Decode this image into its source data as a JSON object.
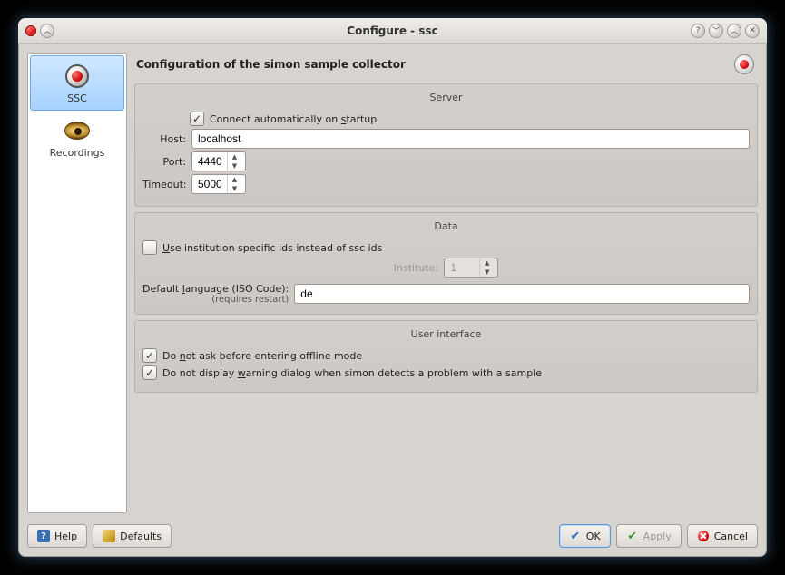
{
  "window": {
    "title": "Configure - ssc"
  },
  "sidebar": {
    "items": [
      {
        "label": "SSC",
        "active": true
      },
      {
        "label": "Recordings",
        "active": false
      }
    ]
  },
  "header": {
    "title": "Configuration of the simon sample collector"
  },
  "server": {
    "group_title": "Server",
    "connect_auto_prefix": "Connect automatically on ",
    "connect_auto_ul": "s",
    "connect_auto_suffix": "tartup",
    "connect_auto_checked": true,
    "host_label": "Host:",
    "host_value": "localhost",
    "port_label": "Port:",
    "port_value": "4440",
    "timeout_label": "Timeout:",
    "timeout_value": "5000"
  },
  "data_sec": {
    "group_title": "Data",
    "inst_ids_ul": "U",
    "inst_ids_suffix": "se institution specific ids instead of ssc ids",
    "inst_ids_checked": false,
    "institute_label": "Institute:",
    "institute_value": "1",
    "lang_label_prefix": "Default ",
    "lang_label_ul": "l",
    "lang_label_suffix": "anguage (ISO Code):",
    "lang_note": "(requires restart)",
    "lang_value": "de"
  },
  "ui_sec": {
    "group_title": "User interface",
    "offline_prefix": "Do ",
    "offline_ul": "n",
    "offline_suffix": "ot ask before entering offline mode",
    "offline_checked": true,
    "warn_prefix": "Do not display ",
    "warn_ul": "w",
    "warn_suffix": "arning dialog when simon detects a problem with a sample",
    "warn_checked": true
  },
  "buttons": {
    "help_ul": "H",
    "help_suffix": "elp",
    "defaults_ul": "D",
    "defaults_suffix": "efaults",
    "ok_ul": "O",
    "ok_suffix": "K",
    "apply_ul": "A",
    "apply_suffix": "pply",
    "cancel_ul": "C",
    "cancel_suffix": "ancel"
  }
}
